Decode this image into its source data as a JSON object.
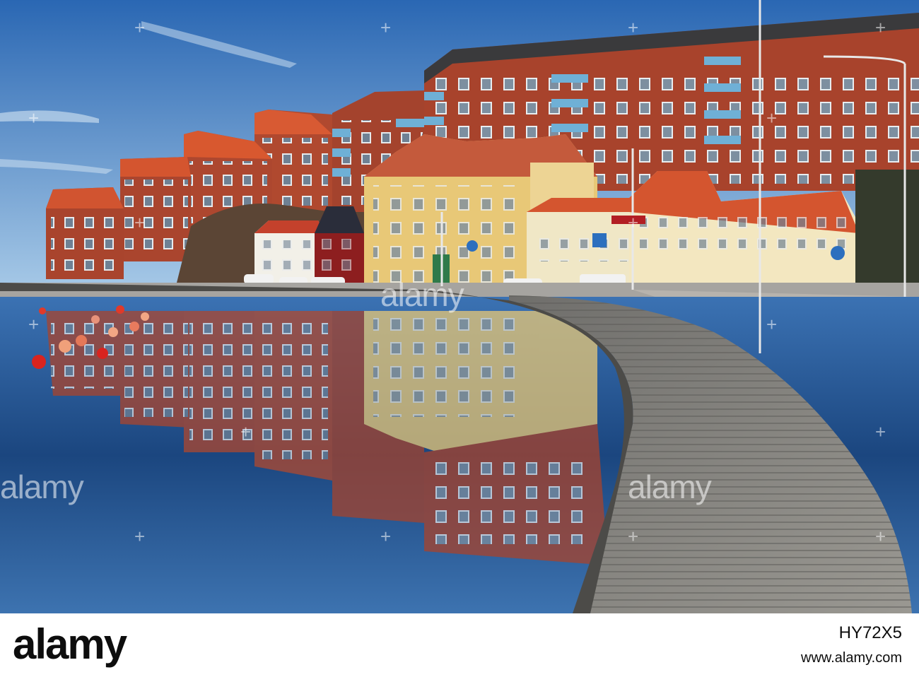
{
  "photo": {
    "subject": "Waterfront with curved wooden boardwalk and brick apartment buildings reflected in calm harbour water",
    "colors": {
      "sky_top": "#2f6fb8",
      "sky_bottom": "#9cc2e4",
      "water": "#1d4a86",
      "brick": "#a8452e",
      "yellow_house": "#e8c777",
      "boardwalk": "#8c8a84",
      "roof": "#d4552f"
    }
  },
  "watermark": {
    "text": "alamy"
  },
  "footer": {
    "logo": "alamy",
    "image_id": "HY72X5",
    "site": "www.alamy.com"
  }
}
